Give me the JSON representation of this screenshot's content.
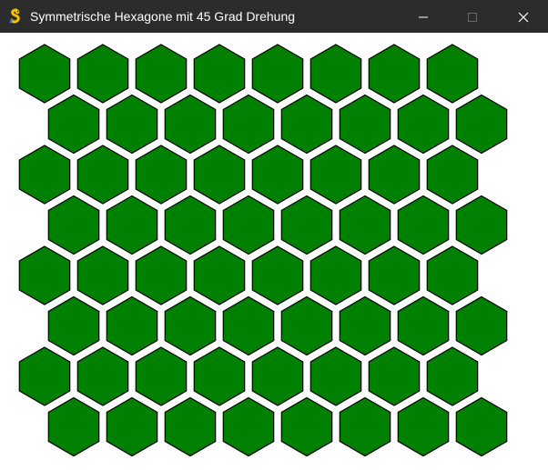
{
  "window": {
    "title": "Symmetrische Hexagone mit 45 Grad Drehung",
    "icon": "pygame-snake-icon",
    "controls": [
      "minimize-icon",
      "maximize-icon",
      "close-icon"
    ]
  },
  "grid": {
    "rows": 8,
    "columns": 8,
    "hex_fill": "#008000",
    "hex_stroke": "#000000",
    "background": "#ffffff"
  },
  "colors": {
    "titlebar": "#2c2c2c",
    "title_text": "#ffffff",
    "disabled_control": "#6a6a6a"
  }
}
